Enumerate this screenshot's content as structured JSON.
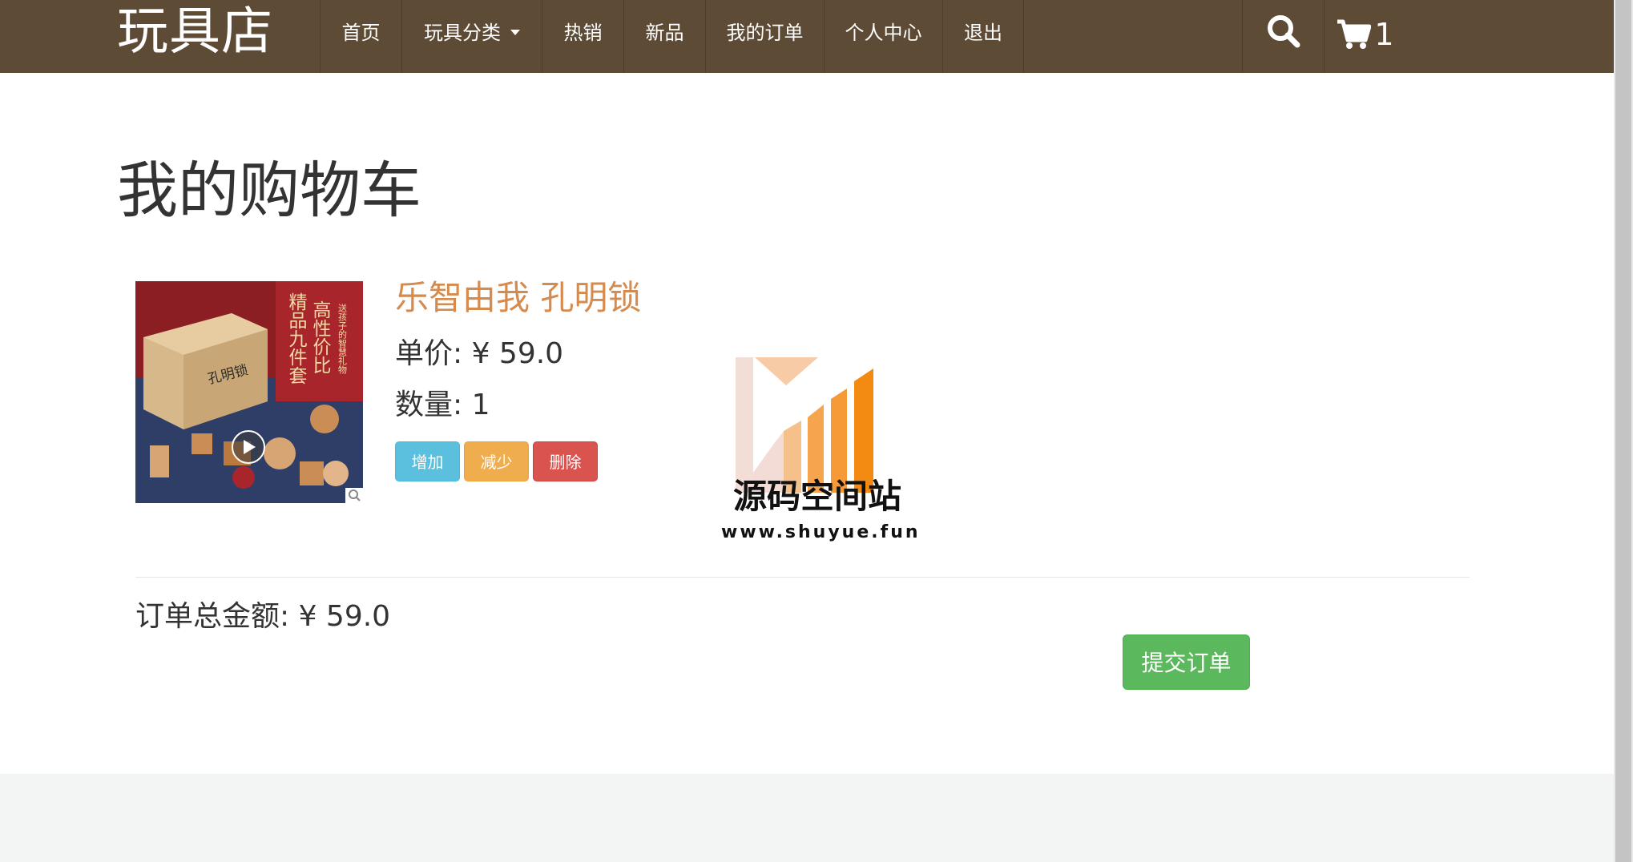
{
  "nav": {
    "brand": "玩具店",
    "items": [
      {
        "label": "首页"
      },
      {
        "label": "玩具分类"
      },
      {
        "label": "热销"
      },
      {
        "label": "新品"
      },
      {
        "label": "我的订单"
      },
      {
        "label": "个人中心"
      },
      {
        "label": "退出"
      }
    ],
    "cart_count": "1",
    "search_icon": "search-icon",
    "cart_icon": "shopping-cart-icon"
  },
  "page": {
    "title": "我的购物车"
  },
  "cart_item": {
    "name": "乐智由我 孔明锁",
    "price": "单价: ¥ 59.0",
    "quantity": "数量: 1",
    "increase_label": "增加",
    "decrease_label": "减少",
    "delete_label": "删除",
    "image_text": {
      "line1": "高性价比",
      "line2": "精品九件套",
      "small": "送孩子的智慧礼物",
      "box_brand": "孔明锁"
    }
  },
  "watermark": {
    "title": "源码空间站",
    "url": "www.shuyue.fun"
  },
  "order": {
    "total": "订单总金额: ¥ 59.0",
    "submit_label": "提交订单"
  },
  "colors": {
    "navbar": "#5e4b35",
    "product_name": "#d58a4e",
    "btn_increase": "#5bc0de",
    "btn_decrease": "#f0ad4e",
    "btn_delete": "#d9534f",
    "btn_submit": "#5cb85c"
  }
}
